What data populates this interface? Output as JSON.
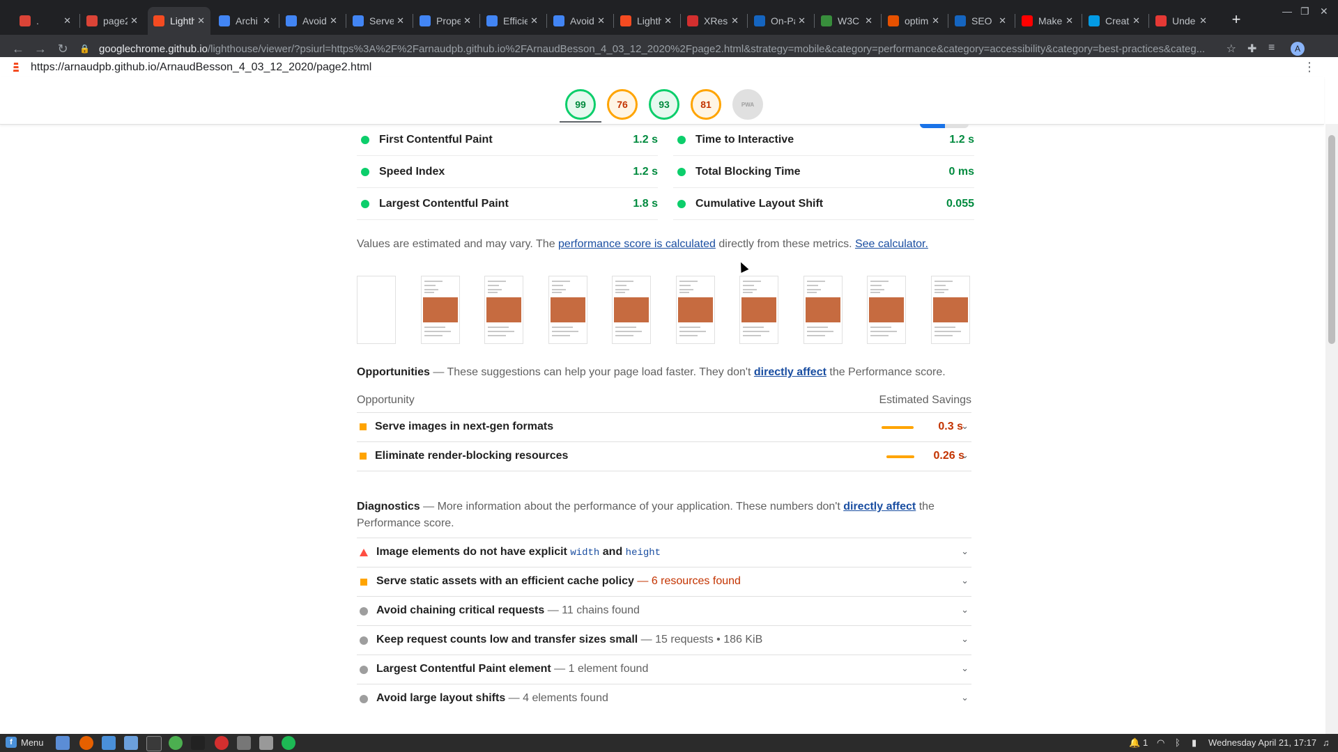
{
  "browser": {
    "tabs": [
      {
        "title": ".",
        "color": "#db4437",
        "icon": "gmail-icon"
      },
      {
        "title": "page2",
        "color": "#db4437",
        "icon": "gmail-icon"
      },
      {
        "title": "Lighth",
        "color": "#f44b21",
        "icon": "lighthouse-icon",
        "active": true
      },
      {
        "title": "Archi",
        "color": "#4285f4",
        "icon": "web-dev-icon"
      },
      {
        "title": "Avoid",
        "color": "#4285f4",
        "icon": "web-dev-icon"
      },
      {
        "title": "Serve",
        "color": "#4285f4",
        "icon": "web-dev-icon"
      },
      {
        "title": "Prope",
        "color": "#4285f4",
        "icon": "web-dev-icon"
      },
      {
        "title": "Efficie",
        "color": "#4285f4",
        "icon": "web-dev-icon"
      },
      {
        "title": "Avoid",
        "color": "#4285f4",
        "icon": "web-dev-icon"
      },
      {
        "title": "Lighth",
        "color": "#f44b21",
        "icon": "lighthouse-icon"
      },
      {
        "title": "XResp",
        "color": "#d32f2f",
        "icon": "xresponsive-icon"
      },
      {
        "title": "On-Pa",
        "color": "#1565c0",
        "icon": "m-icon"
      },
      {
        "title": "W3C",
        "color": "#388e3c",
        "icon": "w3c-icon"
      },
      {
        "title": "optim",
        "color": "#e65100",
        "icon": "optim-icon"
      },
      {
        "title": "SEO",
        "color": "#1565c0",
        "icon": "seo-icon"
      },
      {
        "title": "Make",
        "color": "#ff0000",
        "icon": "youtube-icon"
      },
      {
        "title": "Creat",
        "color": "#039be5",
        "icon": "globe-icon"
      },
      {
        "title": "Unde",
        "color": "#e53935",
        "icon": "ss-icon"
      }
    ],
    "new_tab": "+",
    "url_host": "googlechrome.github.io",
    "url_path": "/lighthouse/viewer/?psiurl=https%3A%2F%2Farnaudpb.github.io%2FArnaudBesson_4_03_12_2020%2Fpage2.html&strategy=mobile&category=performance&category=accessibility&category=best-practices&categ...",
    "profile_initial": "A"
  },
  "report_url": "https://arnaudpb.github.io/ArnaudBesson_4_03_12_2020/page2.html",
  "gauges": [
    {
      "score": "99",
      "status": "pass"
    },
    {
      "score": "76",
      "status": "avg"
    },
    {
      "score": "93",
      "status": "pass"
    },
    {
      "score": "81",
      "status": "avg"
    },
    {
      "score": "PWA",
      "status": "pwa"
    }
  ],
  "metrics": [
    {
      "name": "First Contentful Paint",
      "value": "1.2 s"
    },
    {
      "name": "Time to Interactive",
      "value": "1.2 s"
    },
    {
      "name": "Speed Index",
      "value": "1.2 s"
    },
    {
      "name": "Total Blocking Time",
      "value": "0 ms"
    },
    {
      "name": "Largest Contentful Paint",
      "value": "1.8 s"
    },
    {
      "name": "Cumulative Layout Shift",
      "value": "0.055"
    }
  ],
  "estimate": {
    "prefix": "Values are estimated and may vary. The ",
    "link1": "performance score is calculated",
    "middle": " directly from these metrics. ",
    "link2": "See calculator."
  },
  "opportunities": {
    "title": "Opportunities",
    "desc_prefix": " — These suggestions can help your page load faster. They don't ",
    "link": "directly affect",
    "desc_suffix": " the Performance score.",
    "col_left": "Opportunity",
    "col_right": "Estimated Savings",
    "items": [
      {
        "name": "Serve images in next-gen formats",
        "savings": "0.3 s"
      },
      {
        "name": "Eliminate render-blocking resources",
        "savings": "0.26 s"
      }
    ]
  },
  "diagnostics": {
    "title": "Diagnostics",
    "desc_prefix": " — More information about the performance of your application. These numbers don't ",
    "link": "directly affect",
    "desc_suffix": " the Performance score.",
    "items": [
      {
        "icon": "fail",
        "main": "Image elements do not have explicit ",
        "code1": "width",
        "and": " and ",
        "code2": "height",
        "extra": ""
      },
      {
        "icon": "average",
        "main": "Serve static assets with an efficient cache policy",
        "extra": " — 6 resources found"
      },
      {
        "icon": "info",
        "main": "Avoid chaining critical requests",
        "extra": " — 11 chains found"
      },
      {
        "icon": "info",
        "main": "Keep request counts low and transfer sizes small",
        "extra": " — 15 requests • 186 KiB"
      },
      {
        "icon": "info",
        "main": "Largest Contentful Paint element",
        "extra": " — 1 element found"
      },
      {
        "icon": "info",
        "main": "Avoid large layout shifts",
        "extra": " — 4 elements found"
      }
    ]
  },
  "taskbar": {
    "menu_label": "Menu",
    "notif_count": "1",
    "clock": "Wednesday April 21, 17:17"
  }
}
